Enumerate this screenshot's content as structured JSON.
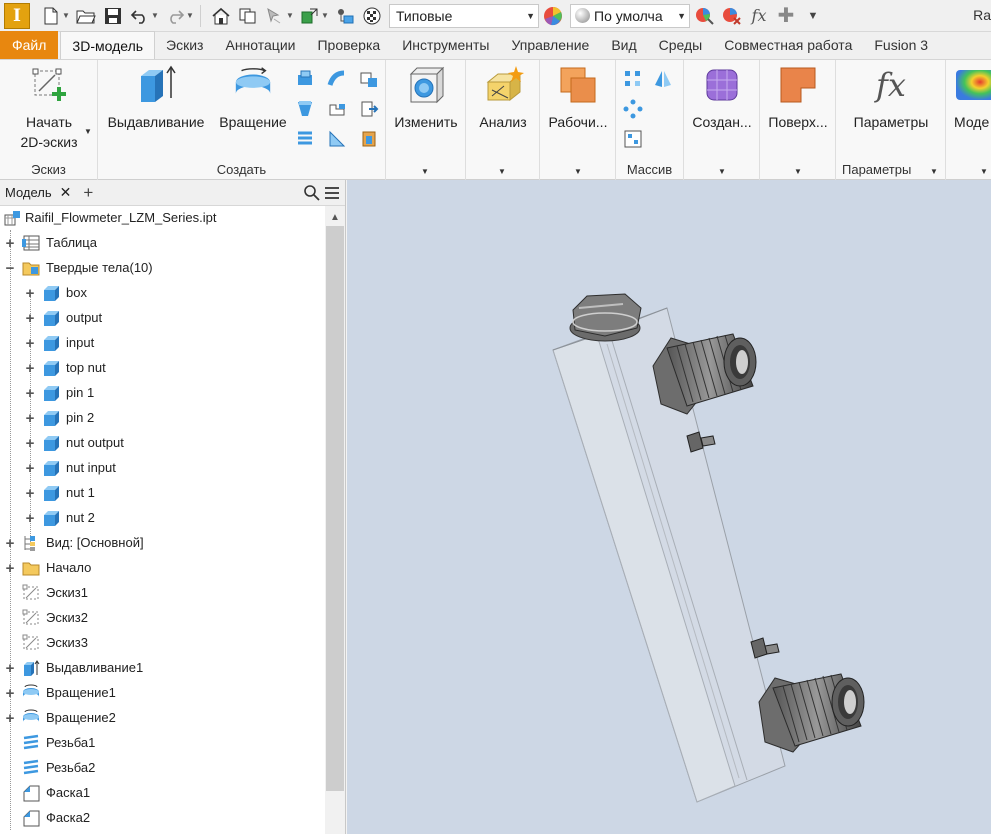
{
  "qat": {
    "appearance_select": "Типовые",
    "material_select": "По умолча",
    "window_title": "Ra"
  },
  "tabs": [
    {
      "label": "Файл"
    },
    {
      "label": "3D-модель"
    },
    {
      "label": "Эскиз"
    },
    {
      "label": "Аннотации"
    },
    {
      "label": "Проверка"
    },
    {
      "label": "Инструменты"
    },
    {
      "label": "Управление"
    },
    {
      "label": "Вид"
    },
    {
      "label": "Среды"
    },
    {
      "label": "Совместная работа"
    },
    {
      "label": "Fusion 3"
    }
  ],
  "ribbon": {
    "sketch_panel": {
      "title": "Эскиз",
      "start_sketch": "Начать\n2D-эскиз"
    },
    "create_panel": {
      "title": "Создать",
      "extrude": "Выдавливание",
      "revolve": "Вращение"
    },
    "modify_panel": {
      "modify": "Изменить"
    },
    "analysis_panel": {
      "analysis": "Анализ"
    },
    "work_panel": {
      "work": "Рабочи..."
    },
    "pattern_panel": {
      "title": "Массив"
    },
    "create_free_panel": {
      "create": "Создан..."
    },
    "surface_panel": {
      "surface": "Поверх..."
    },
    "params_panel": {
      "title": "Параметры",
      "params": "Параметры"
    },
    "model_panel": {
      "model": "Моде"
    }
  },
  "browser": {
    "tab_label": "Модель",
    "tree": [
      {
        "label": "Raifil_Flowmeter_LZM_Series.ipt",
        "icon": "part-icon"
      },
      {
        "label": "Таблица",
        "icon": "table-icon"
      },
      {
        "label": "Твердые тела(10)",
        "icon": "solid-bodies-folder-icon"
      },
      {
        "label": "box",
        "icon": "solid-body-icon"
      },
      {
        "label": "output",
        "icon": "solid-body-icon"
      },
      {
        "label": "input",
        "icon": "solid-body-icon"
      },
      {
        "label": "top nut",
        "icon": "solid-body-icon"
      },
      {
        "label": "pin 1",
        "icon": "solid-body-icon"
      },
      {
        "label": "pin 2",
        "icon": "solid-body-icon"
      },
      {
        "label": "nut output",
        "icon": "solid-body-icon"
      },
      {
        "label": "nut input",
        "icon": "solid-body-icon"
      },
      {
        "label": "nut 1",
        "icon": "solid-body-icon"
      },
      {
        "label": "nut 2",
        "icon": "solid-body-icon"
      },
      {
        "label": "Вид: [Основной]",
        "icon": "view-icon"
      },
      {
        "label": "Начало",
        "icon": "origin-folder-icon"
      },
      {
        "label": "Эскиз1",
        "icon": "sketch-icon"
      },
      {
        "label": "Эскиз2",
        "icon": "sketch-icon"
      },
      {
        "label": "Эскиз3",
        "icon": "sketch-icon"
      },
      {
        "label": "Выдавливание1",
        "icon": "extrude-icon"
      },
      {
        "label": "Вращение1",
        "icon": "revolve-icon"
      },
      {
        "label": "Вращение2",
        "icon": "revolve-icon"
      },
      {
        "label": "Резьба1",
        "icon": "thread-icon"
      },
      {
        "label": "Резьба2",
        "icon": "thread-icon"
      },
      {
        "label": "Фаска1",
        "icon": "chamfer-icon"
      },
      {
        "label": "Фаска2",
        "icon": "chamfer-icon"
      }
    ]
  },
  "colors": {
    "accent_orange": "#e8870f",
    "viewport_bg": "#cdd7e5",
    "body_blue": "#4aa3e8"
  }
}
